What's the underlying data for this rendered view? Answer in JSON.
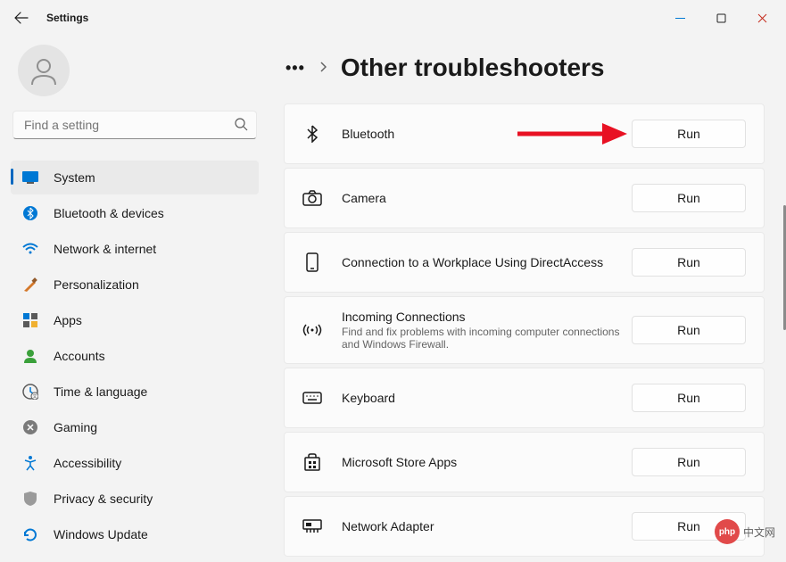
{
  "window": {
    "title": "Settings"
  },
  "search": {
    "placeholder": "Find a setting"
  },
  "nav": {
    "items": [
      {
        "label": "System",
        "icon": "system",
        "active": true
      },
      {
        "label": "Bluetooth & devices",
        "icon": "bluetooth",
        "active": false
      },
      {
        "label": "Network & internet",
        "icon": "wifi",
        "active": false
      },
      {
        "label": "Personalization",
        "icon": "brush",
        "active": false
      },
      {
        "label": "Apps",
        "icon": "apps",
        "active": false
      },
      {
        "label": "Accounts",
        "icon": "accounts",
        "active": false
      },
      {
        "label": "Time & language",
        "icon": "clock",
        "active": false
      },
      {
        "label": "Gaming",
        "icon": "gaming",
        "active": false
      },
      {
        "label": "Accessibility",
        "icon": "accessibility",
        "active": false
      },
      {
        "label": "Privacy & security",
        "icon": "shield",
        "active": false
      },
      {
        "label": "Windows Update",
        "icon": "update",
        "active": false
      }
    ]
  },
  "breadcrumb": {
    "more": "…",
    "page_title": "Other troubleshooters"
  },
  "troubleshooters": [
    {
      "title": "Bluetooth",
      "description": "",
      "icon": "bluetooth",
      "run_label": "Run"
    },
    {
      "title": "Camera",
      "description": "",
      "icon": "camera",
      "run_label": "Run"
    },
    {
      "title": "Connection to a Workplace Using DirectAccess",
      "description": "",
      "icon": "phone",
      "run_label": "Run"
    },
    {
      "title": "Incoming Connections",
      "description": "Find and fix problems with incoming computer connections and Windows Firewall.",
      "icon": "broadcast",
      "run_label": "Run"
    },
    {
      "title": "Keyboard",
      "description": "",
      "icon": "keyboard",
      "run_label": "Run"
    },
    {
      "title": "Microsoft Store Apps",
      "description": "",
      "icon": "store",
      "run_label": "Run"
    },
    {
      "title": "Network Adapter",
      "description": "",
      "icon": "adapter",
      "run_label": "Run"
    }
  ],
  "watermark": {
    "badge": "php",
    "text": "中文网"
  }
}
